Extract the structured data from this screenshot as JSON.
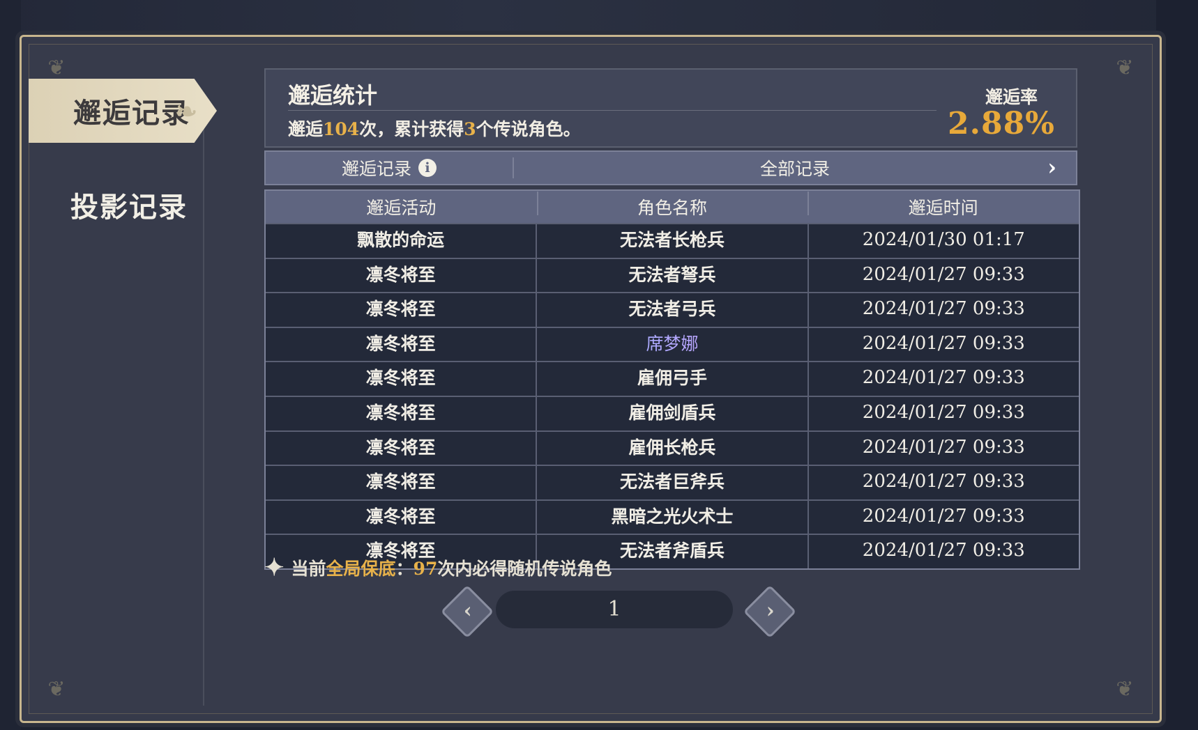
{
  "sidebar": {
    "tabs": [
      {
        "label": "邂逅记录",
        "active": true
      },
      {
        "label": "投影记录",
        "active": false
      }
    ]
  },
  "stats": {
    "title": "邂逅统计",
    "summary_prefix": "邂逅",
    "total_count": "104",
    "summary_mid": "次，累计获得",
    "legend_count": "3",
    "summary_suffix": "个传说角色。",
    "rate_label": "邂逅率",
    "rate_value": "2.88%"
  },
  "filter_bar": {
    "left_label": "邂逅记录",
    "info_icon": "info-icon",
    "right_label": "全部记录",
    "arrow_icon": "chevron-right-icon"
  },
  "table": {
    "headers": [
      "邂逅活动",
      "角色名称",
      "邂逅时间"
    ],
    "rows": [
      {
        "activity": "飘散的命运",
        "character": "无法者长枪兵",
        "time": "2024/01/30 01:17"
      },
      {
        "activity": "凛冬将至",
        "character": "无法者弩兵",
        "time": "2024/01/27 09:33"
      },
      {
        "activity": "凛冬将至",
        "character": "无法者弓兵",
        "time": "2024/01/27 09:33"
      },
      {
        "activity": "凛冬将至",
        "character": "席梦娜",
        "time": "2024/01/27 09:33",
        "legendary": true
      },
      {
        "activity": "凛冬将至",
        "character": "雇佣弓手",
        "time": "2024/01/27 09:33"
      },
      {
        "activity": "凛冬将至",
        "character": "雇佣剑盾兵",
        "time": "2024/01/27 09:33"
      },
      {
        "activity": "凛冬将至",
        "character": "雇佣长枪兵",
        "time": "2024/01/27 09:33"
      },
      {
        "activity": "凛冬将至",
        "character": "无法者巨斧兵",
        "time": "2024/01/27 09:33"
      },
      {
        "activity": "凛冬将至",
        "character": "黑暗之光火术士",
        "time": "2024/01/27 09:33"
      },
      {
        "activity": "凛冬将至",
        "character": "无法者斧盾兵",
        "time": "2024/01/27 09:33"
      }
    ]
  },
  "note": {
    "prefix": "当前",
    "highlight": "全局保底",
    "colon": "：",
    "count": "97",
    "suffix": "次内必得随机传说角色"
  },
  "pager": {
    "current_page": "1",
    "prev_icon": "chevron-left-icon",
    "next_icon": "chevron-right-icon"
  },
  "colors": {
    "accent_gold": "#e8b24a",
    "rate_orange": "#e8a93a",
    "header_bar": "#5f6580",
    "row_bg": "#232939",
    "frame_border": "#c8b68e"
  }
}
